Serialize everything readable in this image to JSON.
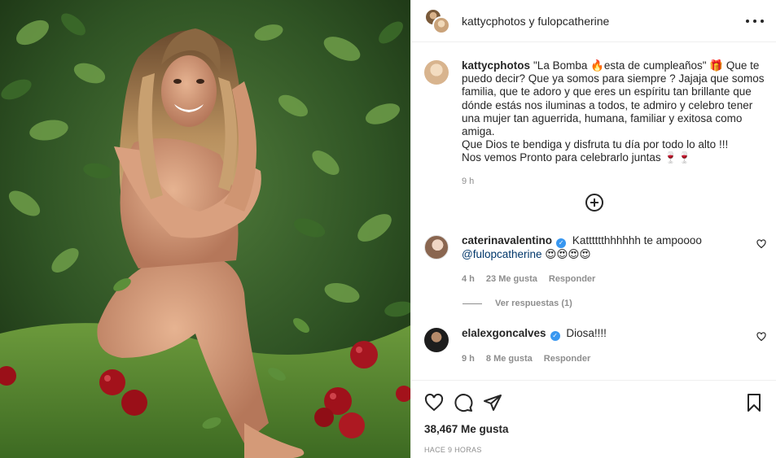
{
  "post": {
    "header": {
      "author": "kattycphotos",
      "joiner": "y",
      "collaborator": "fulopcatherine"
    },
    "caption": {
      "username": "kattycphotos",
      "lines": [
        "\"La Bomba 🔥esta de cumpleaños\" 🎁 Que te puedo decir? Que ya somos para siempre ? Jajaja que somos familia, que te adoro y que eres un espíritu tan brillante que dónde estás nos iluminas a todos, te admiro y celebro tener una mujer tan aguerrida, humana, familiar y exitosa como amiga.",
        "Que Dios te bendiga y disfruta tu día por todo lo alto !!!",
        "Nos vemos Pronto para celebrarlo juntas 🍷🍷"
      ],
      "time": "9 h"
    },
    "comments": [
      {
        "username": "caterinavalentino",
        "verified": true,
        "text": "Katttttthhhhhh te ampoooo",
        "mention": "@fulopcatherine",
        "emojis": "😍😍😍😍",
        "time": "4 h",
        "likes": "23 Me gusta",
        "reply_label": "Responder",
        "view_replies": "Ver respuestas (1)"
      },
      {
        "username": "elalexgoncalves",
        "verified": true,
        "text": "Diosa!!!!",
        "time": "9 h",
        "likes": "8 Me gusta",
        "reply_label": "Responder"
      }
    ],
    "likes_count": "38,467 Me gusta",
    "time_ago": "HACE 9 HORAS"
  },
  "icons": {
    "more": "more-horizontal-icon",
    "load_more": "plus-circle-icon",
    "like": "heart-icon",
    "comment": "comment-icon",
    "share": "paper-plane-icon",
    "save": "bookmark-icon",
    "verified": "verified-badge-icon"
  },
  "colors": {
    "text": "#262626",
    "secondary": "#8e8e8e",
    "verified": "#3897f0",
    "mention": "#00376b",
    "border": "#efefef"
  }
}
